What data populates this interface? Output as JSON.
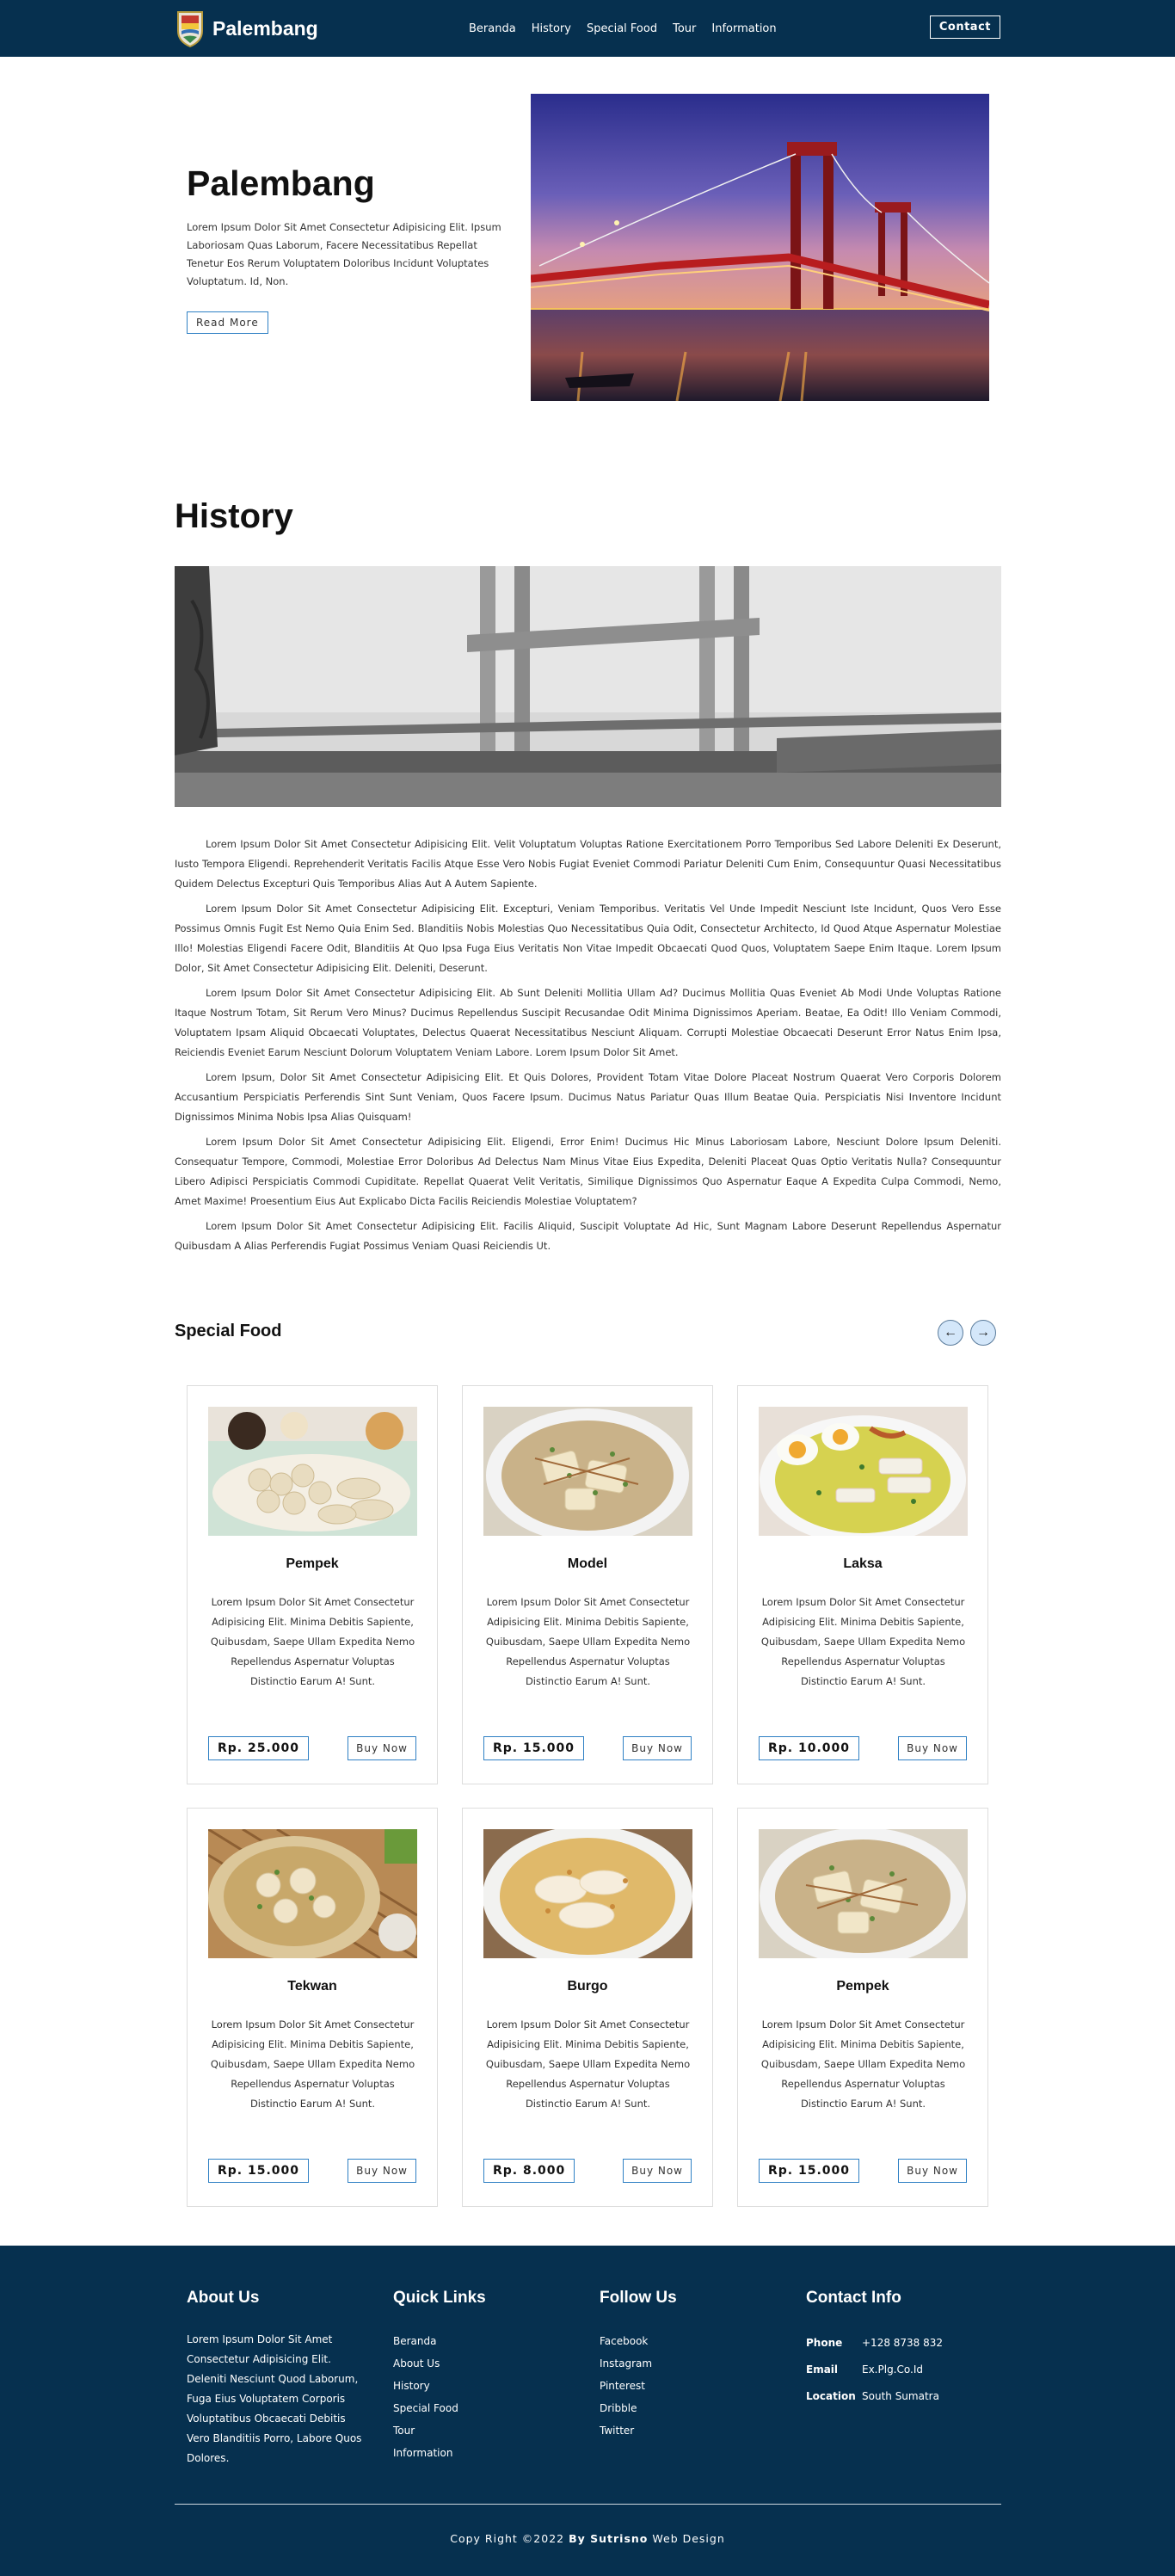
{
  "nav": {
    "brand": "Palembang",
    "links": [
      "Beranda",
      "History",
      "Special Food",
      "Tour",
      "Information"
    ],
    "contact": "Contact"
  },
  "hero": {
    "title": "Palembang",
    "text": "Lorem Ipsum Dolor Sit Amet Consectetur Adipisicing Elit. Ipsum Laboriosam Quas Laborum, Facere Necessitatibus Repellat Tenetur Eos Rerum Voluptatem Doloribus Incidunt Voluptates Voluptatum. Id, Non.",
    "button": "Read More"
  },
  "history": {
    "title": "History",
    "paragraphs": [
      "Lorem Ipsum Dolor Sit Amet Consectetur Adipisicing Elit. Velit Voluptatum Voluptas Ratione Exercitationem Porro Temporibus Sed Labore Deleniti Ex Deserunt, Iusto Tempora Eligendi. Reprehenderit Veritatis Facilis Atque Esse Vero Nobis Fugiat Eveniet Commodi Pariatur Deleniti Cum Enim, Consequuntur Quasi Necessitatibus Quidem Delectus Excepturi Quis Temporibus Alias Aut A Autem Sapiente.",
      "Lorem Ipsum Dolor Sit Amet Consectetur Adipisicing Elit. Excepturi, Veniam Temporibus. Veritatis Vel Unde Impedit Nesciunt Iste Incidunt, Quos Vero Esse Possimus Omnis Fugit Est Nemo Quia Enim Sed. Blanditiis Nobis Molestias Quo Necessitatibus Quia Odit, Consectetur Architecto, Id Quod Atque Aspernatur Molestiae Illo! Molestias Eligendi Facere Odit, Blanditiis At Quo Ipsa Fuga Eius Veritatis Non Vitae Impedit Obcaecati Quod Quos, Voluptatem Saepe Enim Itaque. Lorem Ipsum Dolor, Sit Amet Consectetur Adipisicing Elit. Deleniti, Deserunt.",
      "Lorem Ipsum Dolor Sit Amet Consectetur Adipisicing Elit. Ab Sunt Deleniti Mollitia Ullam Ad? Ducimus Mollitia Quas Eveniet Ab Modi Unde Voluptas Ratione Itaque Nostrum Totam, Sit Rerum Vero Minus? Ducimus Repellendus Suscipit Recusandae Odit Minima Dignissimos Aperiam. Beatae, Ea Odit! Illo Veniam Commodi, Voluptatem Ipsam Aliquid Obcaecati Voluptates, Delectus Quaerat Necessitatibus Nesciunt Aliquam. Corrupti Molestiae Obcaecati Deserunt Error Natus Enim Ipsa, Reiciendis Eveniet Earum Nesciunt Dolorum Voluptatem Veniam Labore. Lorem Ipsum Dolor Sit Amet.",
      "Lorem Ipsum, Dolor Sit Amet Consectetur Adipisicing Elit. Et Quis Dolores, Provident Totam Vitae Dolore Placeat Nostrum Quaerat Vero Corporis Dolorem Accusantium Perspiciatis Perferendis Sint Sunt Veniam, Quos Facere Ipsum. Ducimus Natus Pariatur Quas Illum Beatae Quia. Perspiciatis Nisi Inventore Incidunt Dignissimos Minima Nobis Ipsa Alias Quisquam!",
      "Lorem Ipsum Dolor Sit Amet Consectetur Adipisicing Elit. Eligendi, Error Enim! Ducimus Hic Minus Laboriosam Labore, Nesciunt Dolore Ipsum Deleniti. Consequatur Tempore, Commodi, Molestiae Error Doloribus Ad Delectus Nam Minus Vitae Eius Expedita, Deleniti Placeat Quas Optio Veritatis Nulla? Consequuntur Libero Adipisci Perspiciatis Commodi Cupiditate. Repellat Quaerat Velit Veritatis, Similique Dignissimos Quo Aspernatur Eaque A Expedita Culpa Commodi, Nemo, Amet Maxime! Proesentium Eius Aut Explicabo Dicta Facilis Reiciendis Molestiae Voluptatem?",
      "Lorem Ipsum Dolor Sit Amet Consectetur Adipisicing Elit. Facilis Aliquid, Suscipit Voluptate Ad Hic, Sunt Magnam Labore Deserunt Repellendus Aspernatur Quibusdam A Alias Perferendis Fugiat Possimus Veniam Quasi Reiciendis Ut."
    ]
  },
  "food": {
    "title": "Special Food",
    "desc": "Lorem Ipsum Dolor Sit Amet Consectetur Adipisicing Elit. Minima Debitis Sapiente, Quibusdam, Saepe Ullam Expedita Nemo Repellendus Aspernatur Voluptas Distinctio Earum A! Sunt.",
    "buy": "Buy Now",
    "items": [
      {
        "name": "Pempek",
        "price": "Rp. 25.000"
      },
      {
        "name": "Model",
        "price": "Rp. 15.000"
      },
      {
        "name": "Laksa",
        "price": "Rp. 10.000"
      },
      {
        "name": "Tekwan",
        "price": "Rp. 15.000"
      },
      {
        "name": "Burgo",
        "price": "Rp. 8.000"
      },
      {
        "name": "Pempek",
        "price": "Rp. 15.000"
      }
    ]
  },
  "footer": {
    "about_title": "About Us",
    "about_text": "Lorem Ipsum Dolor Sit Amet Consectetur Adipisicing Elit. Deleniti Nesciunt Quod Laborum, Fuga Eius Voluptatem Corporis Voluptatibus Obcaecati Debitis Vero Blanditiis Porro, Labore Quos Dolores.",
    "quick_title": "Quick Links",
    "quick_links": [
      "Beranda",
      "About Us",
      "History",
      "Special Food",
      "Tour",
      "Information"
    ],
    "follow_title": "Follow Us",
    "follow_links": [
      "Facebook",
      "Instagram",
      "Pinterest",
      "Dribble",
      "Twitter"
    ],
    "contact_title": "Contact Info",
    "contact": [
      {
        "label": "Phone",
        "value": "+128 8738 832"
      },
      {
        "label": "Email",
        "value": "Ex.Plg.Co.Id"
      },
      {
        "label": "Location",
        "value": "South Sumatra"
      }
    ],
    "copyright_pre": "Copy Right ©2022",
    "copyright_by": "By Sutrisno",
    "copyright_post": "Web Design"
  },
  "colors": {
    "navy": "#06304f",
    "accent": "#2f80c4"
  }
}
